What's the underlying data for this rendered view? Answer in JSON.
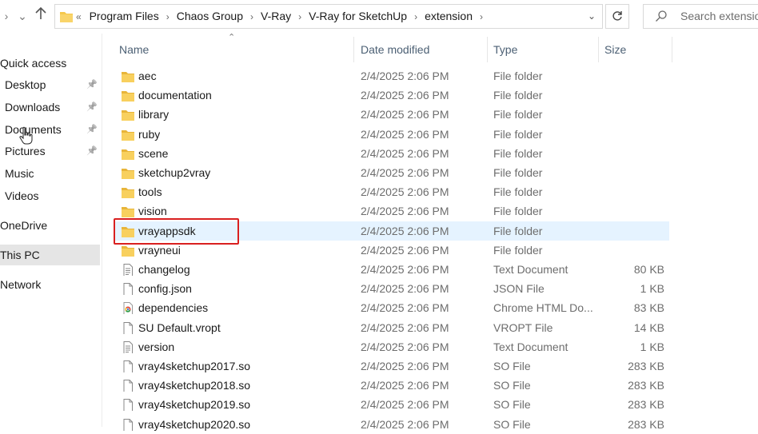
{
  "address_bar": {
    "overflow": "«",
    "crumbs": [
      "Program Files",
      "Chaos Group",
      "V-Ray",
      "V-Ray for SketchUp",
      "extension"
    ]
  },
  "search": {
    "placeholder": "Search extension"
  },
  "sidebar": {
    "items": [
      {
        "label": "Quick access",
        "icon": "star-icon"
      },
      {
        "label": "Desktop",
        "pinned": true
      },
      {
        "label": "Downloads",
        "pinned": true
      },
      {
        "label": "Documents",
        "pinned": true
      },
      {
        "label": "Pictures",
        "pinned": true
      },
      {
        "label": "Music",
        "pinned": false
      },
      {
        "label": "Videos",
        "pinned": false
      },
      {
        "label": "OneDrive"
      },
      {
        "label": "This PC",
        "selected": true
      },
      {
        "label": "Network"
      }
    ]
  },
  "columns": {
    "name": "Name",
    "date": "Date modified",
    "type": "Type",
    "size": "Size"
  },
  "files": [
    {
      "name": "aec",
      "date": "2/4/2025 2:06 PM",
      "type": "File folder",
      "size": "",
      "icon": "folder-icon"
    },
    {
      "name": "documentation",
      "date": "2/4/2025 2:06 PM",
      "type": "File folder",
      "size": "",
      "icon": "folder-icon"
    },
    {
      "name": "library",
      "date": "2/4/2025 2:06 PM",
      "type": "File folder",
      "size": "",
      "icon": "folder-icon"
    },
    {
      "name": "ruby",
      "date": "2/4/2025 2:06 PM",
      "type": "File folder",
      "size": "",
      "icon": "folder-icon"
    },
    {
      "name": "scene",
      "date": "2/4/2025 2:06 PM",
      "type": "File folder",
      "size": "",
      "icon": "folder-icon"
    },
    {
      "name": "sketchup2vray",
      "date": "2/4/2025 2:06 PM",
      "type": "File folder",
      "size": "",
      "icon": "folder-icon"
    },
    {
      "name": "tools",
      "date": "2/4/2025 2:06 PM",
      "type": "File folder",
      "size": "",
      "icon": "folder-icon"
    },
    {
      "name": "vision",
      "date": "2/4/2025 2:06 PM",
      "type": "File folder",
      "size": "",
      "icon": "folder-icon"
    },
    {
      "name": "vrayappsdk",
      "date": "2/4/2025 2:06 PM",
      "type": "File folder",
      "size": "",
      "icon": "folder-icon",
      "highlighted": true
    },
    {
      "name": "vrayneui",
      "date": "2/4/2025 2:06 PM",
      "type": "File folder",
      "size": "",
      "icon": "folder-icon"
    },
    {
      "name": "changelog",
      "date": "2/4/2025 2:06 PM",
      "type": "Text Document",
      "size": "80 KB",
      "icon": "text-file-icon"
    },
    {
      "name": "config.json",
      "date": "2/4/2025 2:06 PM",
      "type": "JSON File",
      "size": "1 KB",
      "icon": "file-icon"
    },
    {
      "name": "dependencies",
      "date": "2/4/2025 2:06 PM",
      "type": "Chrome HTML Do...",
      "size": "83 KB",
      "icon": "chrome-file-icon"
    },
    {
      "name": "SU Default.vropt",
      "date": "2/4/2025 2:06 PM",
      "type": "VROPT File",
      "size": "14 KB",
      "icon": "file-icon"
    },
    {
      "name": "version",
      "date": "2/4/2025 2:06 PM",
      "type": "Text Document",
      "size": "1 KB",
      "icon": "text-file-icon"
    },
    {
      "name": "vray4sketchup2017.so",
      "date": "2/4/2025 2:06 PM",
      "type": "SO File",
      "size": "283 KB",
      "icon": "file-icon"
    },
    {
      "name": "vray4sketchup2018.so",
      "date": "2/4/2025 2:06 PM",
      "type": "SO File",
      "size": "283 KB",
      "icon": "file-icon"
    },
    {
      "name": "vray4sketchup2019.so",
      "date": "2/4/2025 2:06 PM",
      "type": "SO File",
      "size": "283 KB",
      "icon": "file-icon"
    },
    {
      "name": "vray4sketchup2020.so",
      "date": "2/4/2025 2:06 PM",
      "type": "SO File",
      "size": "283 KB",
      "icon": "file-icon"
    }
  ],
  "colors": {
    "folder": "#f5c84c",
    "selection": "#e5f3ff",
    "annotation": "#d92020",
    "header_text": "#4c6074"
  }
}
